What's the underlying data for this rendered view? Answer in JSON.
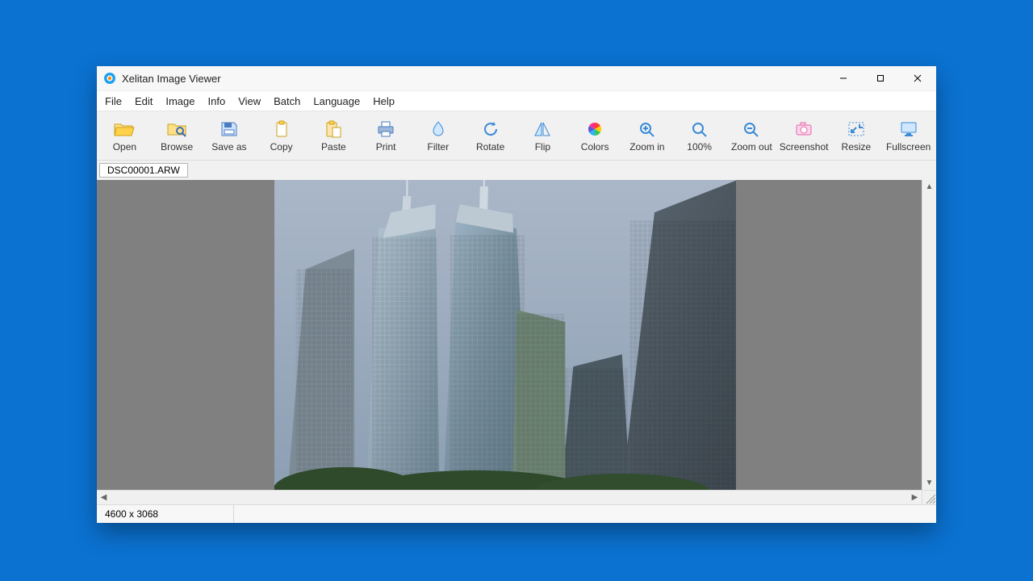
{
  "window": {
    "title": "Xelitan Image Viewer"
  },
  "menu": {
    "items": [
      "File",
      "Edit",
      "Image",
      "Info",
      "View",
      "Batch",
      "Language",
      "Help"
    ]
  },
  "toolbar": {
    "items": [
      {
        "id": "open",
        "label": "Open"
      },
      {
        "id": "browse",
        "label": "Browse"
      },
      {
        "id": "saveas",
        "label": "Save as"
      },
      {
        "id": "copy",
        "label": "Copy"
      },
      {
        "id": "paste",
        "label": "Paste"
      },
      {
        "id": "print",
        "label": "Print"
      },
      {
        "id": "filter",
        "label": "Filter"
      },
      {
        "id": "rotate",
        "label": "Rotate"
      },
      {
        "id": "flip",
        "label": "Flip"
      },
      {
        "id": "colors",
        "label": "Colors"
      },
      {
        "id": "zoomin",
        "label": "Zoom in"
      },
      {
        "id": "zoom100",
        "label": "100%"
      },
      {
        "id": "zoomout",
        "label": "Zoom out"
      },
      {
        "id": "screenshot",
        "label": "Screenshot"
      },
      {
        "id": "resize",
        "label": "Resize"
      },
      {
        "id": "fullscreen",
        "label": "Fullscreen"
      }
    ]
  },
  "tabs": {
    "current": "DSC00001.ARW"
  },
  "status": {
    "dimensions": "4600 x 3068"
  }
}
